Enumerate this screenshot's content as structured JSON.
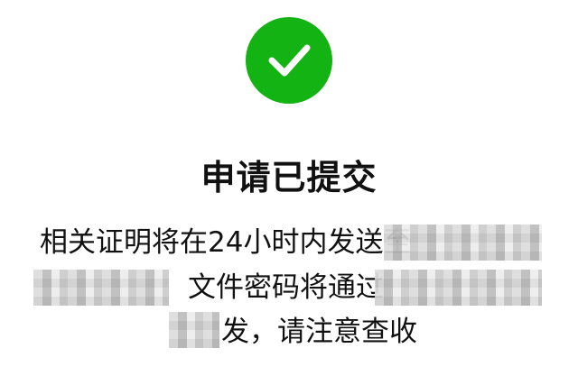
{
  "status": {
    "icon": "check-circle-icon",
    "accent_color": "#12b312",
    "title": "申请已提交"
  },
  "message": {
    "line1": "相关证明将在24小时内发送至",
    "line2": "文件密码将通过",
    "line3": "发，请注意查收"
  }
}
